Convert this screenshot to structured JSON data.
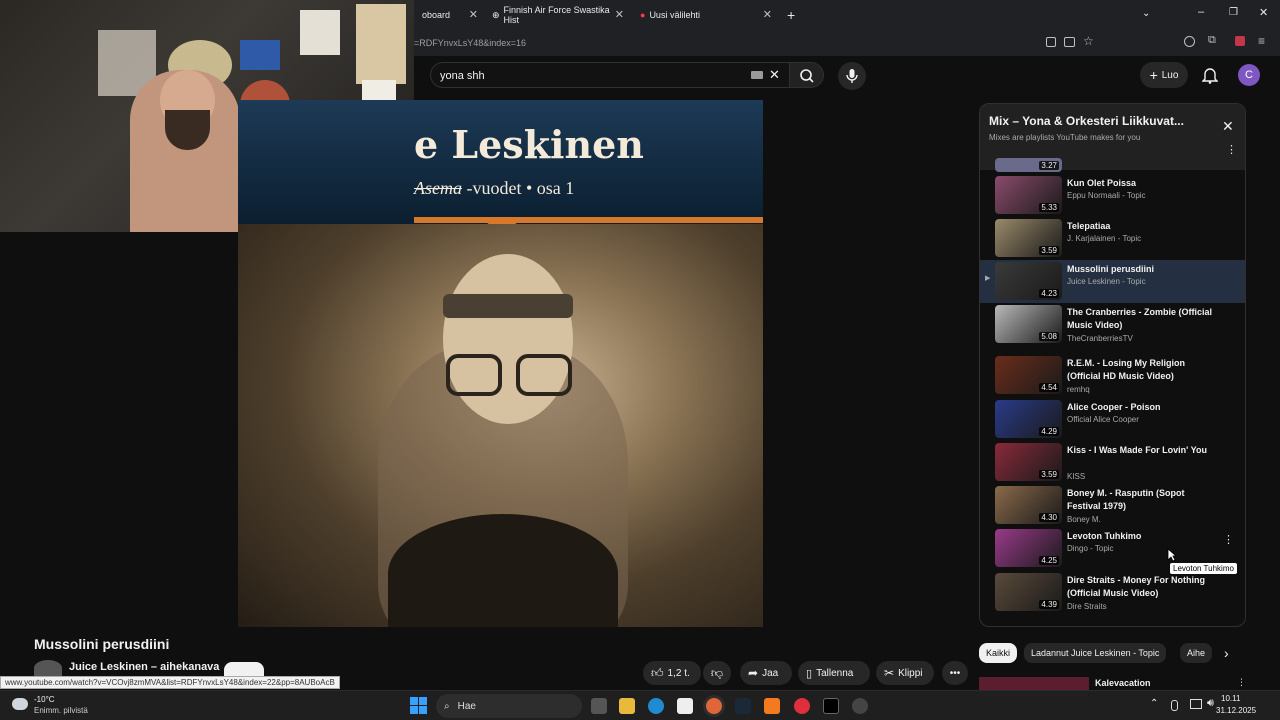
{
  "browser": {
    "tabs": [
      {
        "label": "oboard"
      },
      {
        "label": "Finnish Air Force Swastika Hist"
      },
      {
        "label": "Uusi välilehti"
      }
    ],
    "url": "=RDFYnvxLsY48&index=16",
    "status_url": "www.youtube.com/watch?v=VCOvj8zmMVA&list=RDFYnvxLsY48&index=22&pp=8AUBoAcB"
  },
  "youtube": {
    "search_value": "yona shh",
    "create_label": "Luo",
    "avatar_letter": "C"
  },
  "video": {
    "thumb_title": "e Leskinen",
    "thumb_subtitle_script": "Asema",
    "thumb_subtitle": "-vuodet • osa 1",
    "title": "Mussolini perusdiini",
    "channel": "Juice Leskinen – aihekanava",
    "likes": "1,2 t.",
    "share": "Jaa",
    "save": "Tallenna",
    "clip": "Klippi"
  },
  "playlist": {
    "title": "Mix – Yona & Orkesteri Liikkuvat...",
    "subtitle": "Mixes are playlists YouTube makes for you",
    "partial_duration": "3.27",
    "items": [
      {
        "title": "Kun Olet Poissa",
        "channel": "Eppu Normaali - Topic",
        "duration": "5.33",
        "color": "#8a4b6b"
      },
      {
        "title": "Telepatiaa",
        "channel": "J. Karjalainen - Topic",
        "duration": "3.59",
        "color": "#9a8a6a"
      },
      {
        "title": "Mussolini perusdiini",
        "channel": "Juice Leskinen - Topic",
        "duration": "4.23",
        "color": "#3a3a3a",
        "active": true
      },
      {
        "title": "The Cranberries - Zombie (Official Music Video)",
        "channel": "TheCranberriesTV",
        "duration": "5.08",
        "color": "#b9b9b9"
      },
      {
        "title": "R.E.M. - Losing My Religion (Official HD Music Video)",
        "channel": "remhq",
        "duration": "4.54",
        "color": "#6b2d1b"
      },
      {
        "title": "Alice Cooper - Poison",
        "channel": "Official Alice Cooper",
        "duration": "4.29",
        "color": "#2a3b8a"
      },
      {
        "title": "Kiss - I Was Made For Lovin' You",
        "channel": "KISS",
        "duration": "3.59",
        "color": "#8a2a3a"
      },
      {
        "title": "Boney M. - Rasputin (Sopot Festival 1979)",
        "channel": "Boney M.",
        "duration": "4.30",
        "color": "#8a6a4a"
      },
      {
        "title": "Levoton Tuhkimo",
        "channel": "Dingo - Topic",
        "duration": "4.25",
        "color": "#9a3a8a"
      },
      {
        "title": "Dire Straits - Money For Nothing (Official Music Video)",
        "channel": "Dire Straits",
        "duration": "4.39",
        "color": "#5a4a3a"
      }
    ],
    "tooltip": "Levoton Tuhkimo"
  },
  "chips": [
    "Kaikki",
    "Ladannut Juice Leskinen - Topic",
    "Aihe"
  ],
  "next_item": {
    "title": "Kalevacation"
  },
  "taskbar": {
    "weather_temp": "-10°C",
    "weather_text": "Enimm. pilvistä",
    "search_label": "Hae",
    "time": "10.11",
    "date": "31.12.2025"
  }
}
